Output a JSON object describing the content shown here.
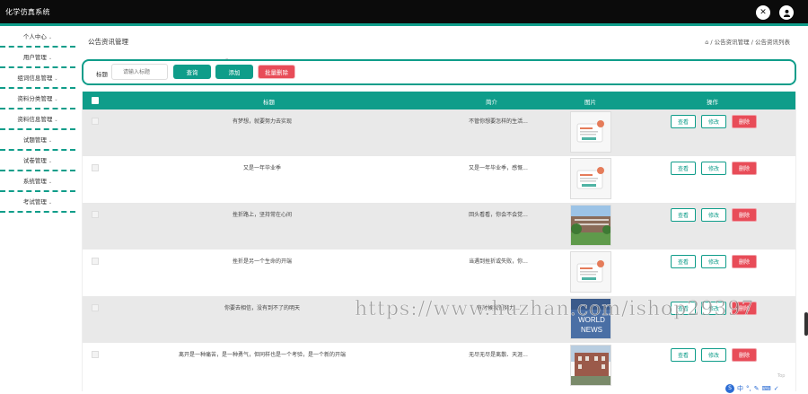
{
  "app": {
    "title": "化学仿真系统"
  },
  "header_icons": [
    "close-circle-icon",
    "user-icon"
  ],
  "sidebar": {
    "items": [
      {
        "label": "个人中心"
      },
      {
        "label": "用户管理"
      },
      {
        "label": "组词信息管理"
      },
      {
        "label": "资料分类管理"
      },
      {
        "label": "资料信息管理"
      },
      {
        "label": "试题管理"
      },
      {
        "label": "试卷管理"
      },
      {
        "label": "系统管理"
      },
      {
        "label": "考试管理"
      }
    ]
  },
  "page": {
    "title": "公告资讯管理",
    "breadcrumb": "/ 公告资讯管理 / 公告资讯列表"
  },
  "search": {
    "label": "标题",
    "placeholder": "请输入标题",
    "query_button": "查询",
    "add_button": "添加",
    "batch_delete_button": "批量删除"
  },
  "table": {
    "headers": [
      "标题",
      "简介",
      "图片",
      "操作"
    ],
    "actions": {
      "view": "查看",
      "edit": "修改",
      "delete": "删除"
    },
    "rows": [
      {
        "title": "有梦想，就要努力去实现",
        "summary": "不管你想要怎样的生活...",
        "image": "illustration"
      },
      {
        "title": "又是一年毕业季",
        "summary": "又是一年毕业季，感慨...",
        "image": "illustration"
      },
      {
        "title": "挫折路上，坚持常在心间",
        "summary": "回头看看，你会不会觉...",
        "image": "campus"
      },
      {
        "title": "挫折是另一个生命的开端",
        "summary": "当遇到挫折或失败，你...",
        "image": "illustration"
      },
      {
        "title": "你要去相信，没有到不了的明天",
        "summary": "有时候我们努力...",
        "image": "news"
      },
      {
        "title": "离开是一种痛苦，是一种勇气，但同样也是一个考验，是一个新的开端",
        "summary": "无尽无尽是离散、天涯...",
        "image": "building"
      }
    ]
  },
  "watermark": "https://www.huzhan.com/ishop29397",
  "ime": {
    "label": "中",
    "top_hint": "Top"
  },
  "colors": {
    "accent": "#0f9d8a",
    "danger": "#e84c58",
    "topbar": "#0b0b0b"
  }
}
